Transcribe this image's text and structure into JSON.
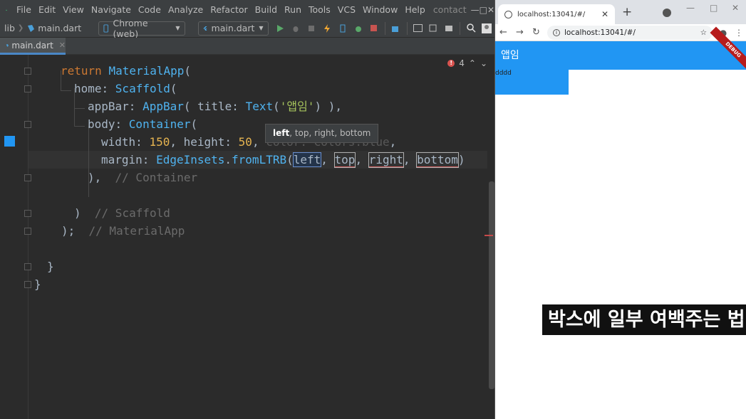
{
  "ide": {
    "menu": [
      "File",
      "Edit",
      "View",
      "Navigate",
      "Code",
      "Analyze",
      "Refactor",
      "Build",
      "Run",
      "Tools",
      "VCS",
      "Window",
      "Help"
    ],
    "project_title": "contact",
    "toolbar": {
      "breadcrumb_lib": "lib",
      "breadcrumb_file": "main.dart",
      "device": "Chrome (web)",
      "run_config": "main.dart"
    },
    "tab": {
      "label": "main.dart"
    },
    "error_count": "4",
    "tooltip": {
      "bold": "left",
      "rest": ", top, right, bottom"
    },
    "code": {
      "l1_kw": "return",
      "l1_cls": "MaterialApp",
      "l1_p": "(",
      "l2_prm": "home: ",
      "l2_cls": "Scaffold",
      "l2_p": "(",
      "l3_prm": "appBar: ",
      "l3_cls": "AppBar",
      "l3_a": "( title: ",
      "l3_cls2": "Text",
      "l3_p1": "(",
      "l3_str": "'앱임'",
      "l3_p2": ") ),",
      "l4_prm": "body: ",
      "l4_cls": "Container",
      "l4_p": "(",
      "l5_prm": "width: ",
      "l5_n1": "150",
      "l5_a": ", height: ",
      "l5_n2": "50",
      "l5_b": ", ",
      "l5_hidden": "color: Colors.blue",
      "l5_c": ",",
      "l6_prm": "margin: ",
      "l6_cls": "EdgeInsets",
      "l6_a": ".",
      "l6_m": "fromLTRB",
      "l6_p": "(",
      "l6_left": "left",
      "l6_c1": ", ",
      "l6_top": "top",
      "l6_c2": ", ",
      "l6_right": "right",
      "l6_c3": ", ",
      "l6_bottom": "bottom",
      "l6_end": ")",
      "l7_p": "),  ",
      "l7_cm": "// Container",
      "l9_p": ")  ",
      "l9_cm": "// Scaffold",
      "l10_p": ");  ",
      "l10_cm": "// MaterialApp",
      "l12_p": "}",
      "l13_p": "}"
    }
  },
  "browser": {
    "tab_title": "localhost:13041/#/",
    "url": "localhost:13041/#/",
    "app_title": "앱임",
    "debug_label": "DEBUG",
    "body_text": "dddd",
    "caption": "박스에 일부 여백주는 법"
  },
  "colors": {
    "flutter_blue": "#2196f3",
    "ide_bg": "#2b2b2b",
    "caption_bg": "#111111"
  }
}
